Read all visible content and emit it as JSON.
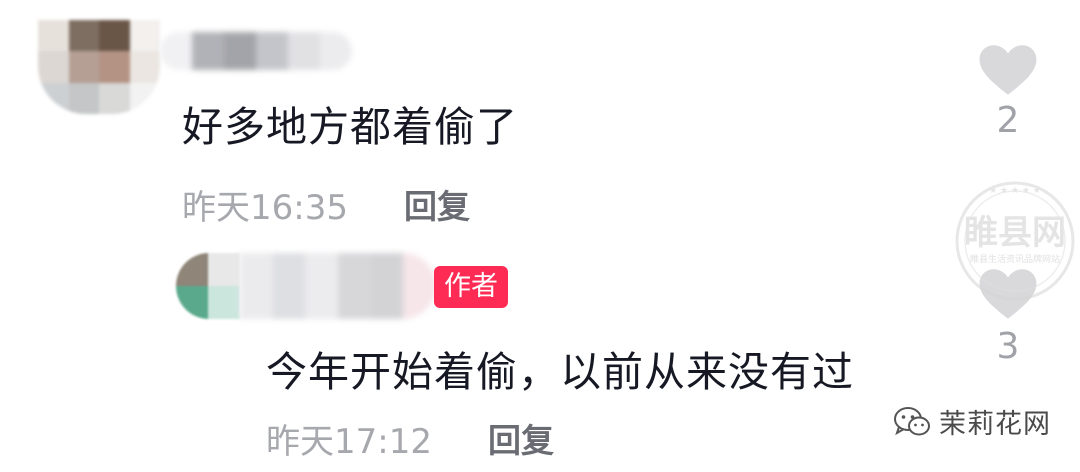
{
  "comments": [
    {
      "text": "好多地方都着偷了",
      "time": "昨天16:35",
      "reply_label": "回复",
      "likes": "2"
    },
    {
      "author_badge": "作者",
      "text": "今年开始着偷，以前从来没有过",
      "time": "昨天17:12",
      "reply_label": "回复",
      "likes": "3"
    }
  ],
  "watermark": {
    "text": "睢县网",
    "subtitle": "睢县生活资讯品牌网站"
  },
  "brand": {
    "name": "茉莉花网"
  },
  "colors": {
    "text": "#161823",
    "meta": "#a6a8ad",
    "reply": "#6a6c73",
    "badge": "#fe2c55",
    "heart": "#d9d9dc"
  },
  "icons": [
    "heart-icon",
    "wechat-icon"
  ]
}
